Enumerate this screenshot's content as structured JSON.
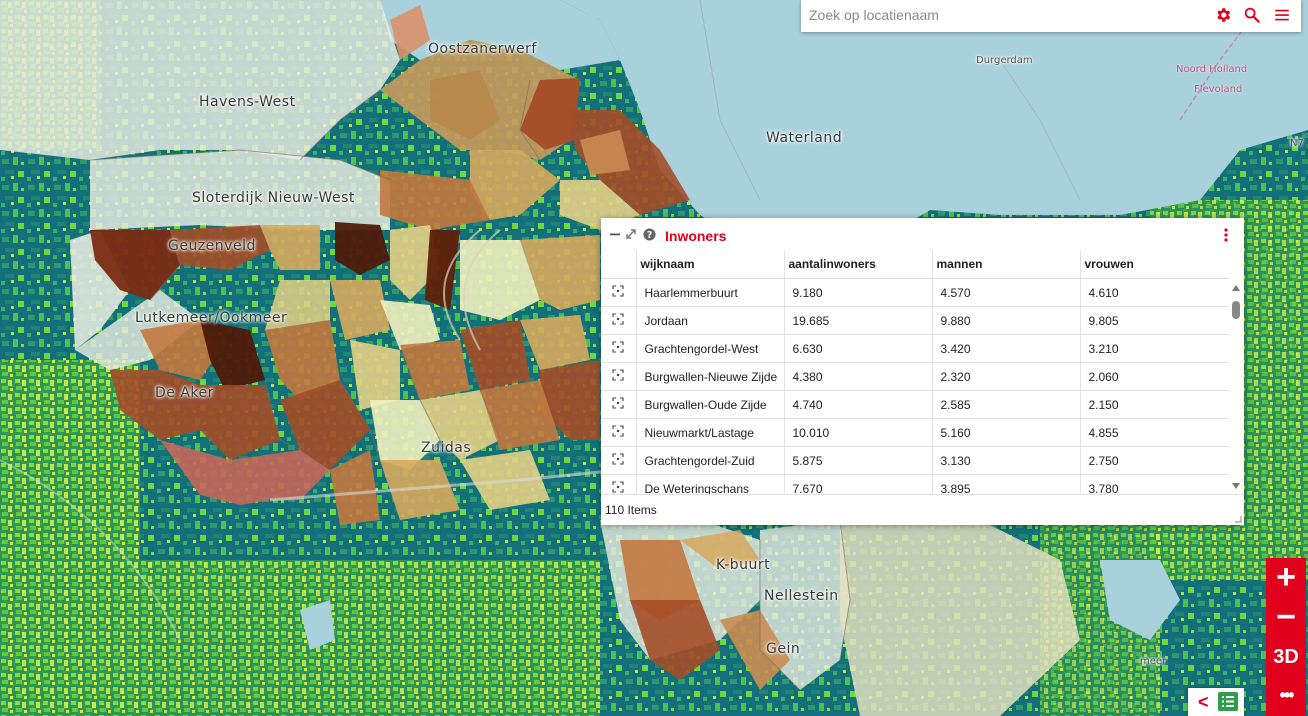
{
  "search": {
    "placeholder": "Zoek op locatienaam",
    "icons": [
      "gear-icon",
      "search-icon",
      "menu-icon"
    ]
  },
  "map": {
    "labels": {
      "oostzanerwerf": "Oostzanerwerf",
      "havens_west": "Havens-West",
      "waterland": "Waterland",
      "sloterdijk": "Sloterdijk Nieuw-West",
      "geuzenveld": "Geuzenveld",
      "lutkemeer": "Lutkemeer/Ookmeer",
      "de_aker": "De Aker",
      "zuidas": "Zuidas",
      "k_buurt": "K-buurt",
      "nellestein": "Nellestein",
      "gein": "Gein",
      "noord_holland": "Noord Holland",
      "flevoland": "Flevoland",
      "durgerdam": "Durgerdam",
      "n7": "N7",
      "meer": "meer"
    },
    "colors": {
      "water": "#a9d1dc",
      "vegetation_dark": "#0e6b74",
      "vegetation_light": "#5ed33a",
      "choropleth": [
        "#f2efbf",
        "#e3cf86",
        "#d6a85e",
        "#c2783f",
        "#a44c28",
        "#7a2a12",
        "#4e1a0a"
      ]
    }
  },
  "panel": {
    "title": "Inwoners",
    "columns": [
      "wijknaam",
      "aantalinwoners",
      "mannen",
      "vrouwen"
    ],
    "rows": [
      [
        "Haarlemmerbuurt",
        "9.180",
        "4.570",
        "4.610"
      ],
      [
        "Jordaan",
        "19.685",
        "9.880",
        "9.805"
      ],
      [
        "Grachtengordel-West",
        "6.630",
        "3.420",
        "3.210"
      ],
      [
        "Burgwallen-Nieuwe Zijde",
        "4.380",
        "2.320",
        "2.060"
      ],
      [
        "Burgwallen-Oude Zijde",
        "4.740",
        "2.585",
        "2.150"
      ],
      [
        "Nieuwmarkt/Lastage",
        "10.010",
        "5.160",
        "4.855"
      ],
      [
        "Grachtengordel-Zuid",
        "5.875",
        "3.130",
        "2.750"
      ],
      [
        "De Weteringschans",
        "7.670",
        "3.895",
        "3.780"
      ]
    ],
    "footer": "110 Items",
    "accent": "#e0001b"
  },
  "controls": {
    "zoom_in": "+",
    "zoom_out": "−",
    "mode_3d": "3D",
    "more": "•••",
    "collapse": "<",
    "accent": "#e0001b",
    "list_icon_color": "#2e9e4a"
  }
}
